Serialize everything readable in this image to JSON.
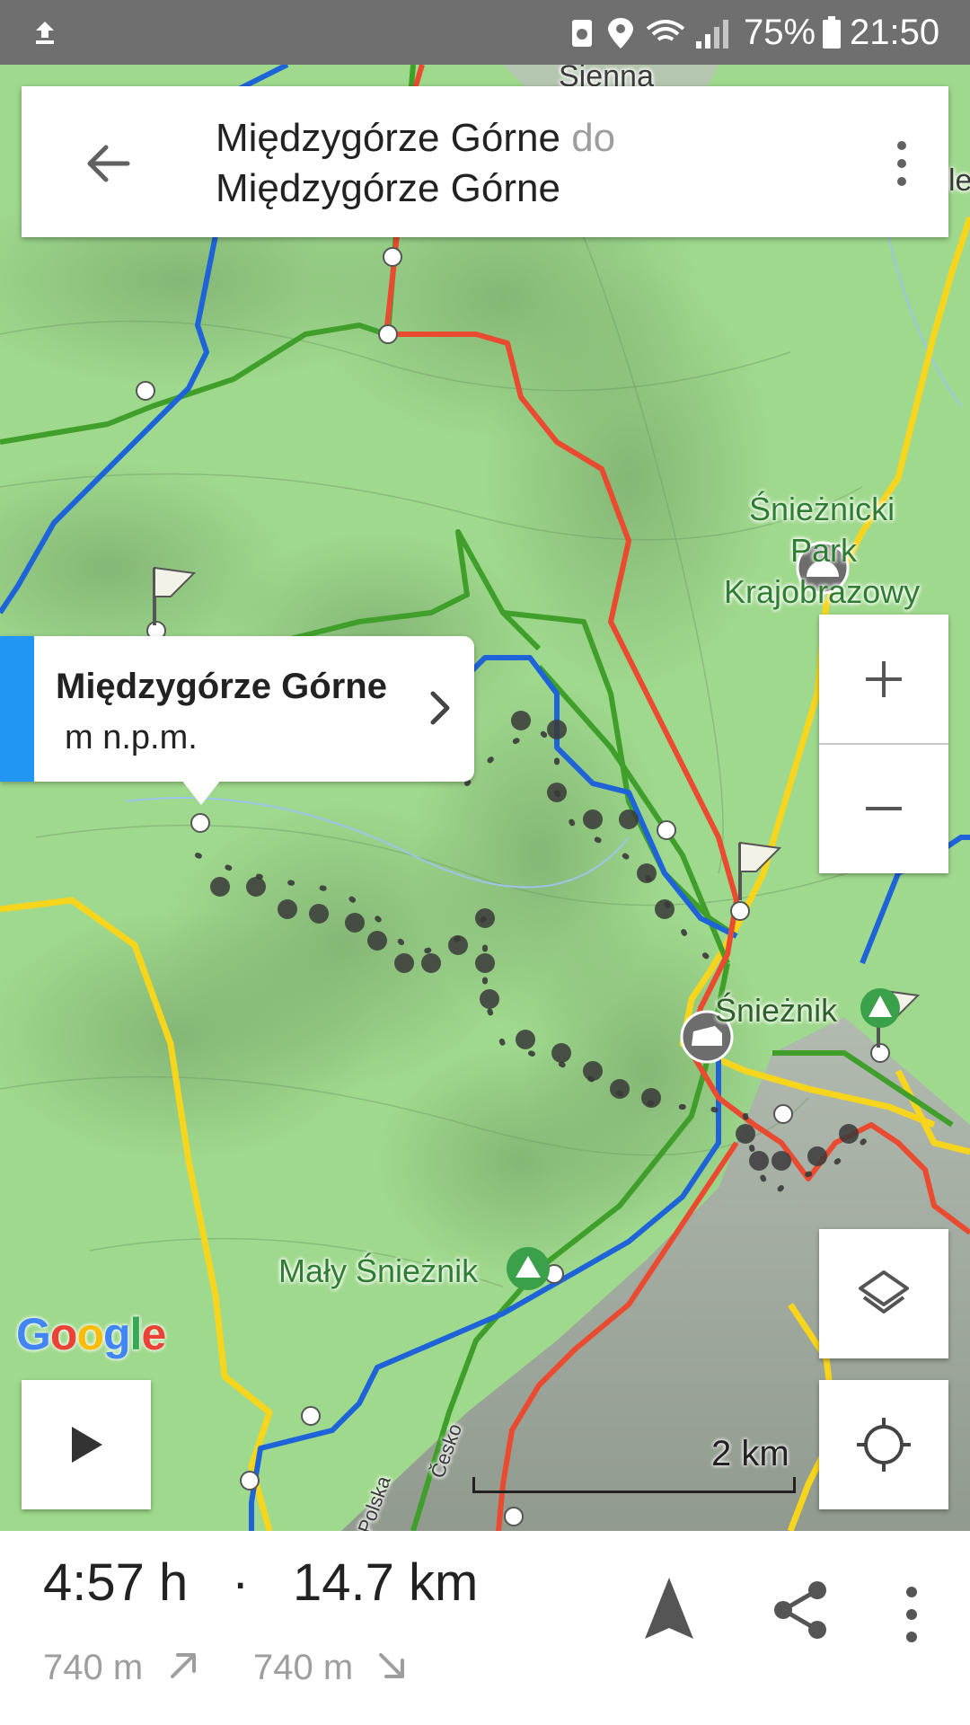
{
  "status_bar": {
    "battery": "75%",
    "time": "21:50",
    "icons": [
      "upload-icon",
      "recycle-icon",
      "location-icon",
      "wifi-icon",
      "signal-icon",
      "battery-icon"
    ]
  },
  "header": {
    "origin": "Międzygórze Górne",
    "connector": "do",
    "destination": "Międzygórze Górne",
    "back_icon": "arrow-back-icon",
    "menu_icon": "more-vertical-icon"
  },
  "map": {
    "labels": {
      "top_place": "Sienna",
      "park_line1": "Śnieżnicki",
      "park_line2": "Park",
      "park_line3": "Krajobrazowy",
      "peak": "Śnieżnik",
      "small_peak": "Mały Śnieżnik",
      "border_cz": "Česko",
      "border_pl": "Polska",
      "right_edge": "le"
    },
    "logo": [
      "G",
      "o",
      "o",
      "g",
      "l",
      "e"
    ],
    "scale_label": "2 km",
    "colors": {
      "terrain": "#9fd98d",
      "red_trail": "#ea4a2f",
      "green_trail": "#3f9f2a",
      "blue_trail": "#1f63d8",
      "yellow_trail": "#f7d51d",
      "route_dots": "#3a3a3a",
      "accent": "#2196f3"
    }
  },
  "callout": {
    "title": "Międzygórze Górne",
    "subtitle": "m n.p.m.",
    "icon": "chevron-right-icon"
  },
  "controls": {
    "zoom_in_icon": "plus-icon",
    "zoom_out_icon": "minus-icon",
    "layers_icon": "layers-icon",
    "play_icon": "play-icon",
    "locate_icon": "my-location-icon"
  },
  "summary": {
    "duration": "4:57 h",
    "separator": "·",
    "distance": "14.7 km",
    "ascent": "740 m",
    "descent": "740 m",
    "navigate_icon": "navigation-arrow-icon",
    "share_icon": "share-icon",
    "menu_icon": "more-vertical-icon"
  }
}
